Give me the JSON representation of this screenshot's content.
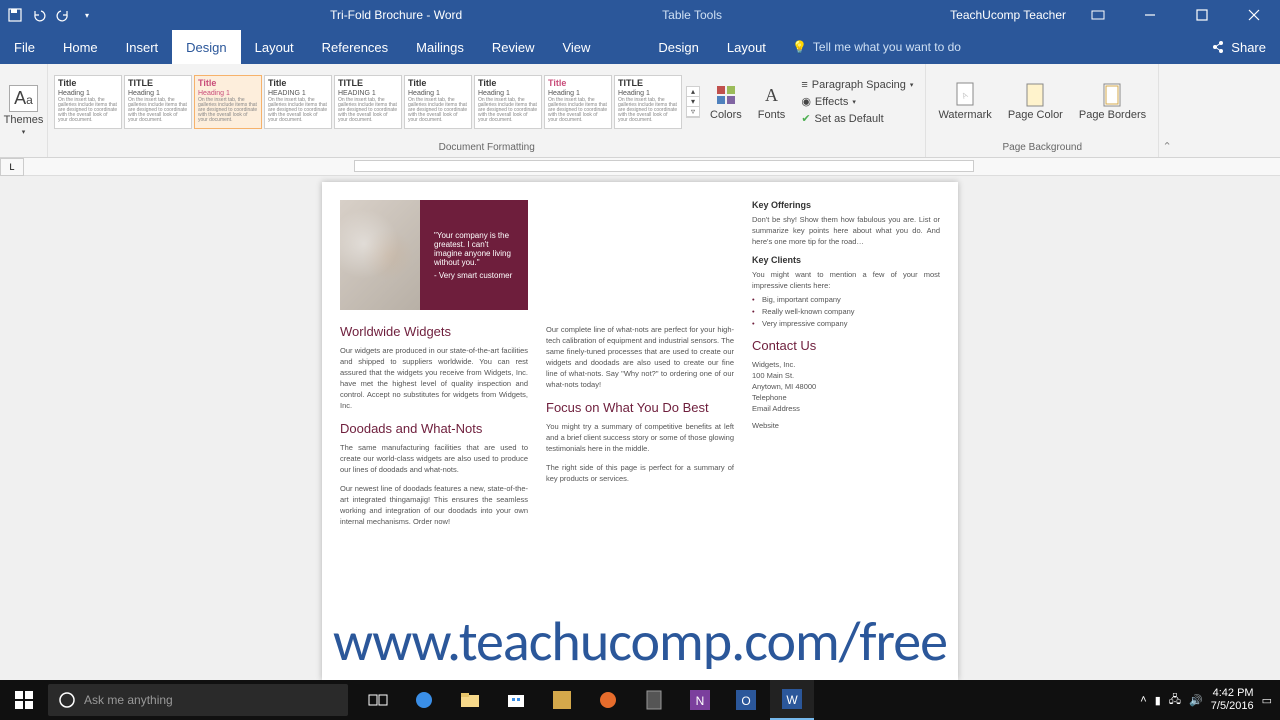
{
  "titlebar": {
    "doc_title": "Tri-Fold Brochure - Word",
    "context_tab": "Table Tools",
    "account": "TeachUcomp Teacher"
  },
  "tabs": {
    "file": "File",
    "home": "Home",
    "insert": "Insert",
    "design": "Design",
    "layout": "Layout",
    "references": "References",
    "mailings": "Mailings",
    "review": "Review",
    "view": "View",
    "tt_design": "Design",
    "tt_layout": "Layout",
    "tellme": "Tell me what you want to do",
    "share": "Share"
  },
  "ribbon": {
    "themes": "Themes",
    "doc_formatting": "Document Formatting",
    "colors": "Colors",
    "fonts": "Fonts",
    "para_spacing": "Paragraph Spacing",
    "effects": "Effects",
    "set_default": "Set as Default",
    "watermark": "Watermark",
    "page_color": "Page Color",
    "page_borders": "Page Borders",
    "page_background": "Page Background",
    "gallery": [
      {
        "title": "Title",
        "heading": "Heading 1"
      },
      {
        "title": "TITLE",
        "heading": "Heading 1"
      },
      {
        "title": "Title",
        "heading": "Heading 1"
      },
      {
        "title": "Title",
        "heading": "HEADING 1"
      },
      {
        "title": "TITLE",
        "heading": "HEADING 1"
      },
      {
        "title": "Title",
        "heading": "Heading 1"
      },
      {
        "title": "Title",
        "heading": "Heading 1"
      },
      {
        "title": "Title",
        "heading": "Heading 1"
      },
      {
        "title": "TITLE",
        "heading": "Heading 1"
      }
    ]
  },
  "doc": {
    "quote": "\"Your company is the greatest. I can't imagine anyone living without you.\"",
    "quote_attr": "- Very smart customer",
    "col1": {
      "h1": "Worldwide Widgets",
      "p1": "Our widgets are produced in our state-of-the-art facilities and shipped to suppliers worldwide. You can rest assured that the widgets you receive from Widgets, Inc. have met the highest level of quality inspection and control.",
      "p1b": "Accept no substitutes for widgets from Widgets, Inc.",
      "h2": "Doodads and What-Nots",
      "p2": "The same manufacturing facilities that are used to create our world-class widgets are also used to produce our lines of doodads and what-nots.",
      "p3": "Our newest line of doodads features a new, state-of-the-art integrated thingamajig! This ensures the seamless working and integration of our doodads into your own internal mechanisms. Order now!"
    },
    "col2": {
      "p1": "Our complete line of what-nots are perfect for your high-tech calibration of equipment and industrial sensors. The same finely-tuned processes that are used to create our widgets and doodads are also used to create our fine line of what-nots. Say \"Why not?\" to ordering one of our what-nots today!",
      "h1": "Focus on What You Do Best",
      "p2": "You might try a summary of competitive benefits at left and a brief client success story or some of those glowing testimonials here in the middle.",
      "p3": "The right side of this page is perfect for a summary of key products or services."
    },
    "col3": {
      "h1": "Key Offerings",
      "p1": "Don't be shy! Show them how fabulous you are. List or summarize key points here about what you do. And here's one more tip for the road…",
      "h2": "Key Clients",
      "p2": "You might want to mention a few of your most impressive clients here:",
      "clients": [
        "Big, important company",
        "Really well-known company",
        "Very impressive company"
      ],
      "contact_h": "Contact Us",
      "addr1": "Widgets, Inc.",
      "addr2": "100 Main St.",
      "addr3": "Anytown, MI 48000",
      "addr4": "Telephone",
      "addr5": "Email Address",
      "addr6": "Website"
    }
  },
  "overlay_url": "www.teachucomp.com/free",
  "taskbar": {
    "search_placeholder": "Ask me anything",
    "time": "4:42 PM",
    "date": "7/5/2016"
  }
}
